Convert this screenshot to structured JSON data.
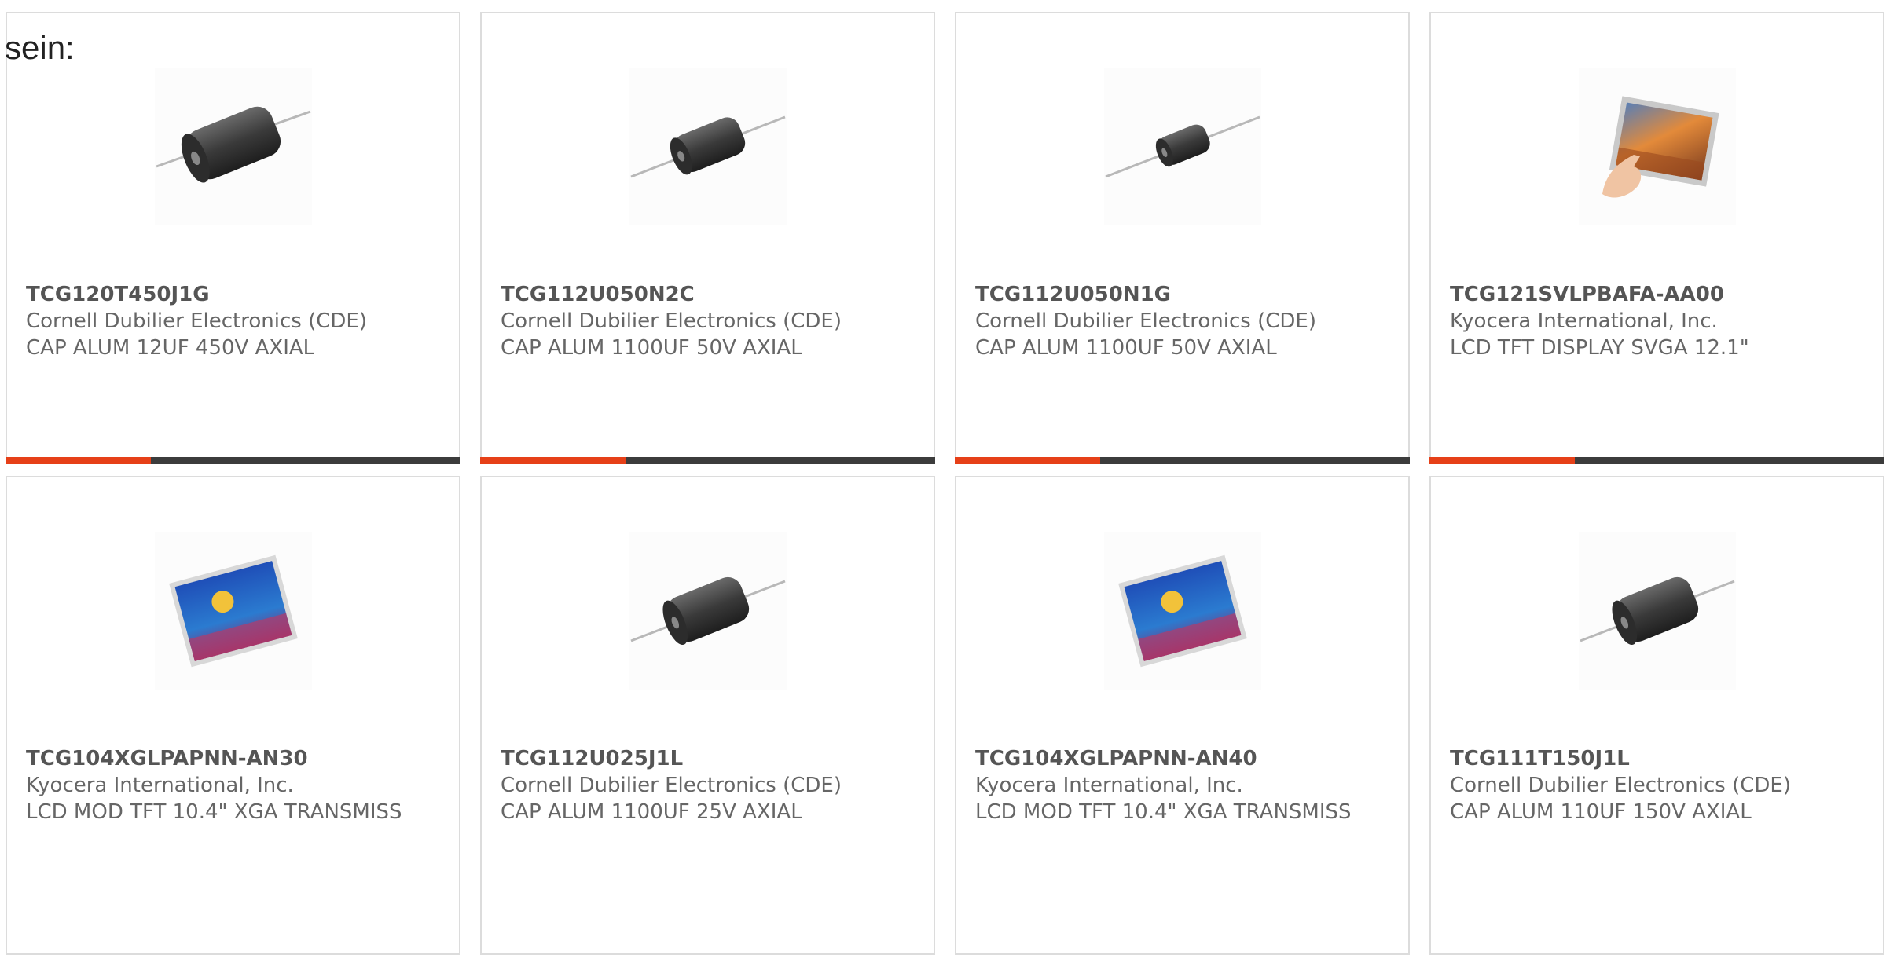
{
  "intro": "sein:",
  "products": [
    {
      "part": "TCG120T450J1G",
      "manufacturer": "Cornell Dubilier Electronics (CDE)",
      "description": "CAP ALUM 12UF 450V AXIAL",
      "image": "axial-capacitor-large"
    },
    {
      "part": "TCG112U050N2C",
      "manufacturer": "Cornell Dubilier Electronics (CDE)",
      "description": "CAP ALUM 1100UF 50V AXIAL",
      "image": "axial-capacitor-medium"
    },
    {
      "part": "TCG112U050N1G",
      "manufacturer": "Cornell Dubilier Electronics (CDE)",
      "description": "CAP ALUM 1100UF 50V AXIAL",
      "image": "axial-capacitor-small"
    },
    {
      "part": "TCG121SVLPBAFA-AA00",
      "manufacturer": "Kyocera International, Inc.",
      "description": "LCD TFT DISPLAY SVGA 12.1\"",
      "image": "touch-display"
    },
    {
      "part": "TCG104XGLPAPNN-AN30",
      "manufacturer": "Kyocera International, Inc.",
      "description": "LCD MOD TFT 10.4\" XGA TRANSMISS",
      "image": "lcd-module"
    },
    {
      "part": "TCG112U025J1L",
      "manufacturer": "Cornell Dubilier Electronics (CDE)",
      "description": "CAP ALUM 1100UF 25V AXIAL",
      "image": "axial-capacitor-medium"
    },
    {
      "part": "TCG104XGLPAPNN-AN40",
      "manufacturer": "Kyocera International, Inc.",
      "description": "LCD MOD TFT 10.4\" XGA TRANSMISS",
      "image": "lcd-module"
    },
    {
      "part": "TCG111T150J1L",
      "manufacturer": "Cornell Dubilier Electronics (CDE)",
      "description": "CAP ALUM 110UF 150V AXIAL",
      "image": "axial-capacitor-medium"
    }
  ],
  "colors": {
    "accent": "#e64018",
    "bar": "#3c3c3c",
    "border": "#dcdcdc",
    "text": "#666666"
  }
}
